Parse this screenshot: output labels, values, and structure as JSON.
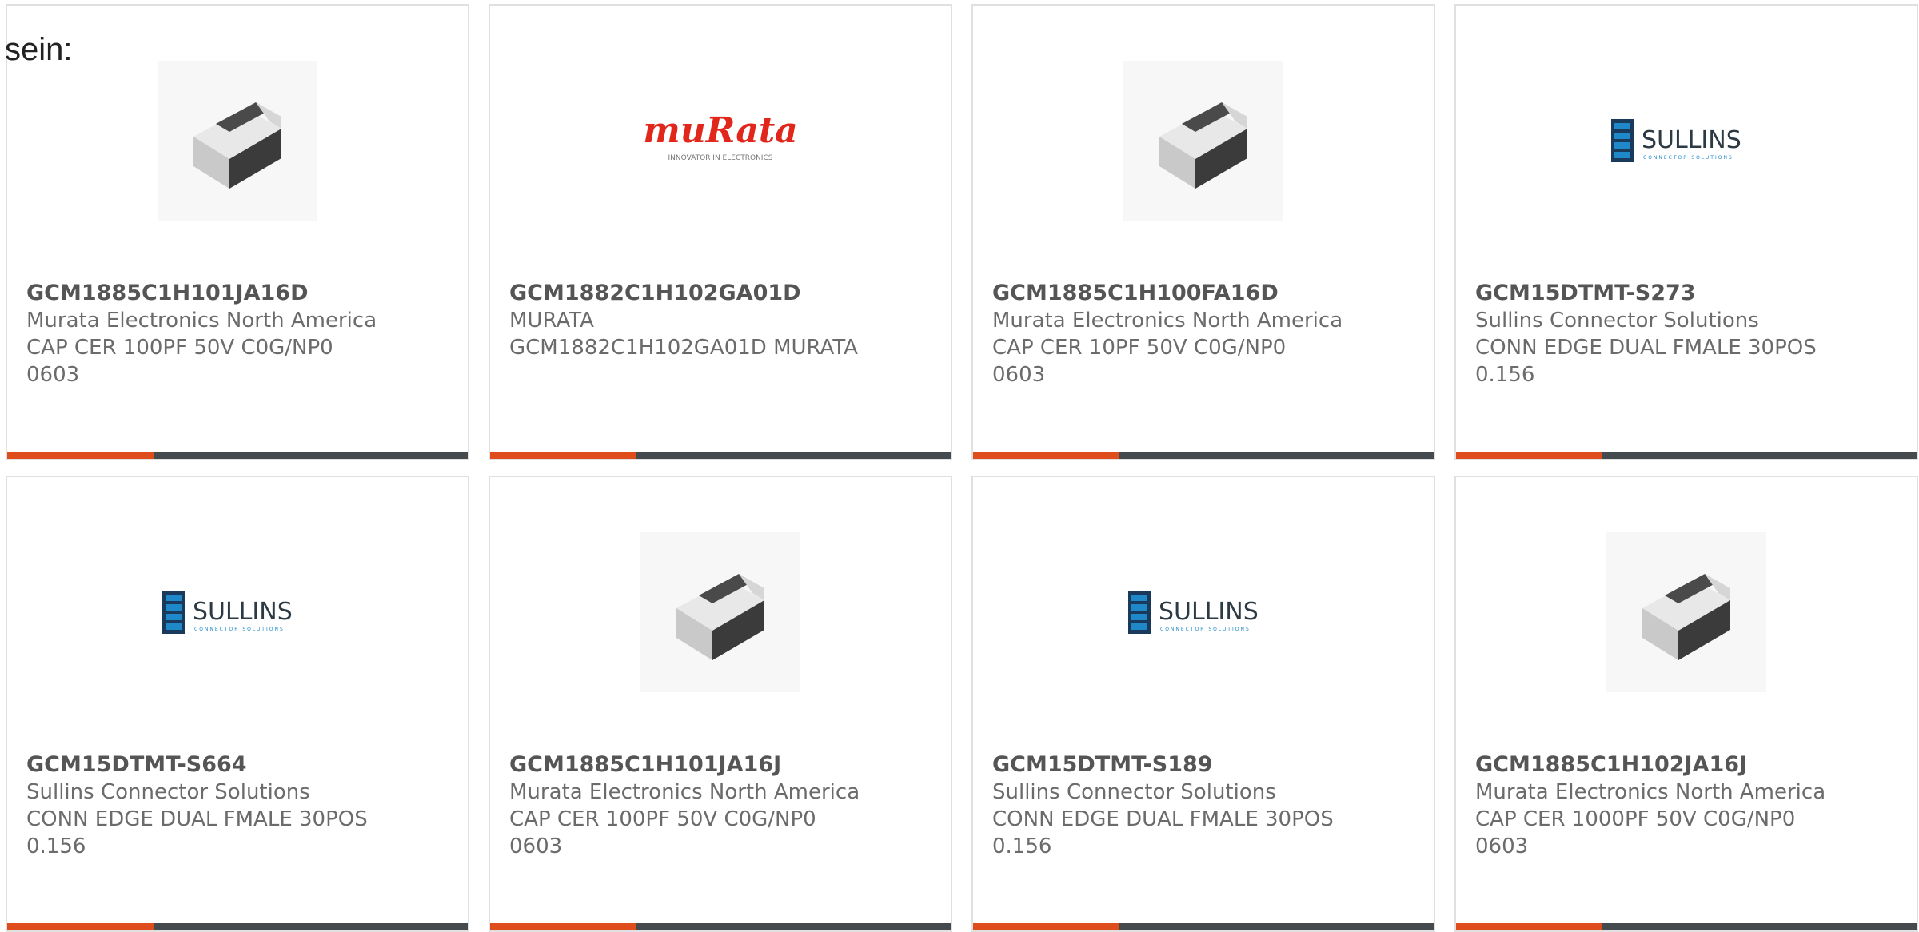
{
  "intro_text": "sein:",
  "colors": {
    "accent": "#e04d1c",
    "bar": "#444a4e",
    "border": "#e0e0e0"
  },
  "cards": [
    {
      "part_number": "GCM1885C1H101JA16D",
      "manufacturer": "Murata Electronics North America",
      "desc1": "CAP CER 100PF 50V C0G/NP0",
      "desc2": "0603",
      "image": "capacitor-chip-icon"
    },
    {
      "part_number": "GCM1882C1H102GA01D",
      "manufacturer": "MURATA",
      "desc1": "GCM1882C1H102GA01D MURATA",
      "desc2": "",
      "image": "murata-logo",
      "logo_text": "muRata",
      "logo_tagline": "INNOVATOR IN ELECTRONICS"
    },
    {
      "part_number": "GCM1885C1H100FA16D",
      "manufacturer": "Murata Electronics North America",
      "desc1": "CAP CER 10PF 50V C0G/NP0",
      "desc2": "0603",
      "image": "capacitor-chip-icon"
    },
    {
      "part_number": "GCM15DTMT-S273",
      "manufacturer": "Sullins Connector Solutions",
      "desc1": "CONN EDGE DUAL FMALE 30POS",
      "desc2": "0.156",
      "image": "sullins-logo",
      "logo_text": "SULLINS",
      "logo_tagline": "CONNECTOR SOLUTIONS"
    },
    {
      "part_number": "GCM15DTMT-S664",
      "manufacturer": "Sullins Connector Solutions",
      "desc1": "CONN EDGE DUAL FMALE 30POS",
      "desc2": "0.156",
      "image": "sullins-logo",
      "logo_text": "SULLINS",
      "logo_tagline": "CONNECTOR SOLUTIONS"
    },
    {
      "part_number": "GCM1885C1H101JA16J",
      "manufacturer": "Murata Electronics North America",
      "desc1": "CAP CER 100PF 50V C0G/NP0",
      "desc2": "0603",
      "image": "capacitor-chip-icon"
    },
    {
      "part_number": "GCM15DTMT-S189",
      "manufacturer": "Sullins Connector Solutions",
      "desc1": "CONN EDGE DUAL FMALE 30POS",
      "desc2": "0.156",
      "image": "sullins-logo",
      "logo_text": "SULLINS",
      "logo_tagline": "CONNECTOR SOLUTIONS"
    },
    {
      "part_number": "GCM1885C1H102JA16J",
      "manufacturer": "Murata Electronics North America",
      "desc1": "CAP CER 1000PF 50V C0G/NP0",
      "desc2": "0603",
      "image": "capacitor-chip-icon"
    }
  ]
}
